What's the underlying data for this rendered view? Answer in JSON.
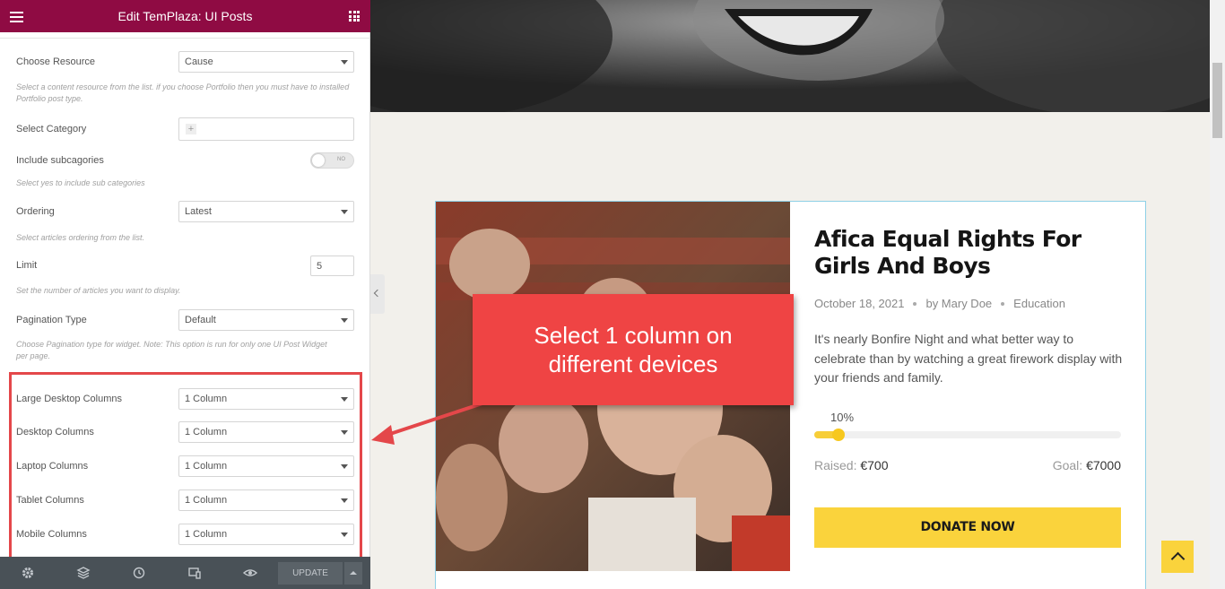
{
  "editor": {
    "title": "Edit TemPlaza: UI Posts",
    "fields": {
      "resource": {
        "label": "Choose Resource",
        "value": "Cause",
        "desc": "Select a content resource from the list. if you choose Portfolio then you must have to installed Portfolio post type."
      },
      "category": {
        "label": "Select Category",
        "plus": "+"
      },
      "subcats": {
        "label": "Include subcagories",
        "toggle": "NO",
        "desc": "Select yes to include sub categories"
      },
      "ordering": {
        "label": "Ordering",
        "value": "Latest",
        "desc": "Select articles ordering from the list."
      },
      "limit": {
        "label": "Limit",
        "value": "5",
        "desc": "Set the number of articles you want to display."
      },
      "pagination": {
        "label": "Pagination Type",
        "value": "Default",
        "desc": "Choose Pagination type for widget. Note: This option is run for only one UI Post Widget per page."
      },
      "columns": [
        {
          "label": "Large Desktop Columns",
          "value": "1 Column"
        },
        {
          "label": "Desktop Columns",
          "value": "1 Column"
        },
        {
          "label": "Laptop Columns",
          "value": "1 Column"
        },
        {
          "label": "Tablet Columns",
          "value": "1 Column"
        },
        {
          "label": "Mobile Columns",
          "value": "1 Column"
        }
      ]
    },
    "toolbar": {
      "update": "UPDATE",
      "icons": [
        "gear-icon",
        "layers-icon",
        "history-icon",
        "responsive-icon",
        "eye-icon"
      ]
    }
  },
  "preview": {
    "card": {
      "title": "Afica Equal Rights For Girls And Boys",
      "date": "October 18, 2021",
      "author": "by Mary Doe",
      "category": "Education",
      "excerpt": "It's nearly Bonfire Night and what better way to celebrate than by watching a great firework display with your friends and family.",
      "progress_label": "10%",
      "progress": 0.1,
      "raised_label": "Raised:",
      "raised_value": "€700",
      "goal_label": "Goal:",
      "goal_value": "€7000",
      "donate": "DONATE NOW"
    }
  },
  "callout": {
    "line1": "Select 1 column on",
    "line2": "different devices"
  },
  "colors": {
    "header": "#8f0b43",
    "accent": "#fad33c",
    "callout": "#ef4444"
  }
}
